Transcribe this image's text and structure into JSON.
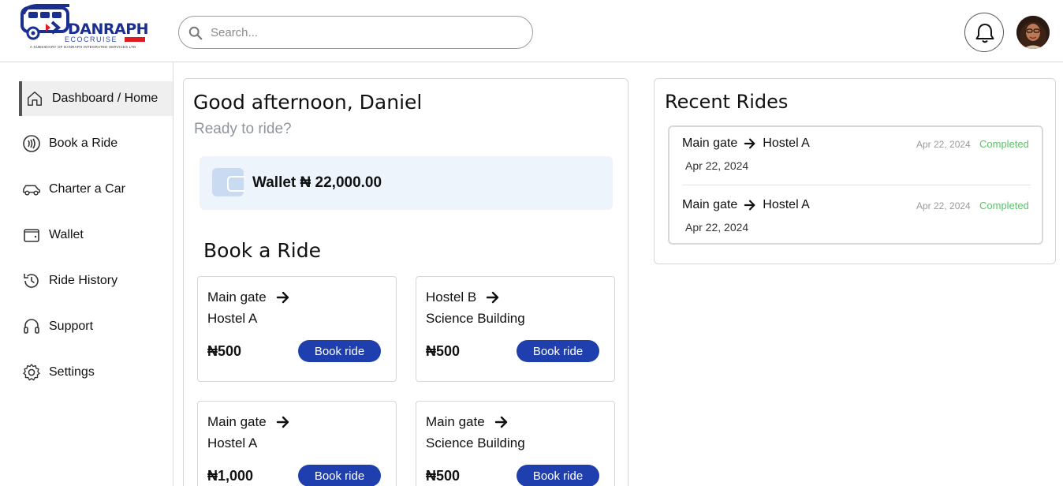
{
  "header": {
    "logo": {
      "brand": "DANRAPH",
      "sub": "ECOCRUISE",
      "tagline": "A SUBSIDIARY OF DANRAPH INTEGRATED SERVICES LTD"
    },
    "search": {
      "placeholder": "Search..."
    },
    "notification_icon": "bell-icon",
    "avatar_icon": "user-avatar"
  },
  "sidebar": {
    "items": [
      {
        "label": "Dashboard / Home",
        "icon": "home-icon",
        "active": true
      },
      {
        "label": "Book a Ride",
        "icon": "contactless-icon",
        "active": false
      },
      {
        "label": "Charter a Car",
        "icon": "car-icon",
        "active": false
      },
      {
        "label": "Wallet",
        "icon": "wallet-icon",
        "active": false
      },
      {
        "label": "Ride History",
        "icon": "history-icon",
        "active": false
      },
      {
        "label": "Support",
        "icon": "headset-icon",
        "active": false
      },
      {
        "label": "Settings",
        "icon": "gear-icon",
        "active": false
      }
    ]
  },
  "main": {
    "greeting": "Good afternoon, Daniel",
    "subtitle": "Ready to ride?",
    "wallet": {
      "label": "Wallet ₦ 22,000.00"
    },
    "book_title": "Book a Ride",
    "rides": [
      {
        "from": "Main gate",
        "to": "Hostel A",
        "price": "₦500",
        "button": "Book ride"
      },
      {
        "from": "Hostel B",
        "to": "Science Building",
        "price": "₦500",
        "button": "Book ride"
      },
      {
        "from": "Main gate",
        "to": "Hostel A",
        "price": "₦1,000",
        "button": "Book ride"
      },
      {
        "from": "Main gate",
        "to": "Science Building",
        "price": "₦500",
        "button": "Book ride"
      }
    ]
  },
  "recent": {
    "title": "Recent Rides",
    "items": [
      {
        "from": "Main gate",
        "to": "Hostel A",
        "date": "Apr 22, 2024",
        "date_right": "Apr 22, 2024",
        "status": "Completed"
      },
      {
        "from": "Main gate",
        "to": "Hostel A",
        "date": "Apr 22, 2024",
        "date_right": "Apr 22, 2024",
        "status": "Completed"
      }
    ]
  },
  "colors": {
    "primary_button": "#1f3fae",
    "status_completed": "#5ec26a",
    "wallet_bg": "#eef4fc",
    "brand_blue": "#1b2f8f",
    "brand_red": "#e21b23"
  }
}
